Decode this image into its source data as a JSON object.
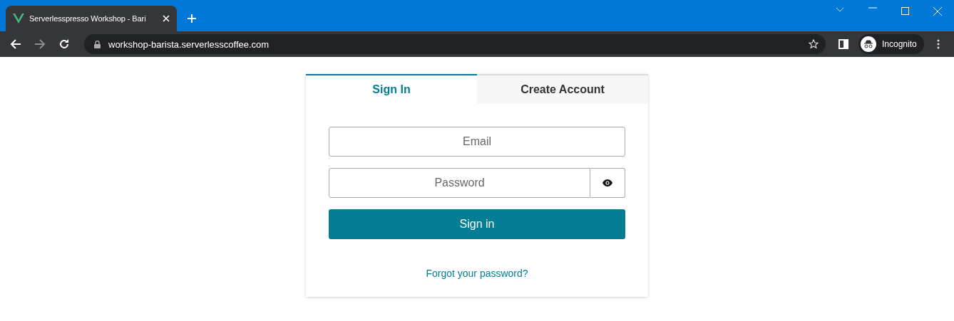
{
  "browser": {
    "tab_title": "Serverlesspresso Workshop - Bari",
    "url": "workshop-barista.serverlesscoffee.com",
    "profile": "Incognito"
  },
  "tabs": [
    {
      "label": "Sign In",
      "selected": true
    },
    {
      "label": "Create Account",
      "selected": false
    }
  ],
  "form": {
    "email": {
      "placeholder": "Email"
    },
    "password": {
      "placeholder": "Password"
    },
    "submit": "Sign in",
    "forgot_link": "Forgot your password?"
  }
}
